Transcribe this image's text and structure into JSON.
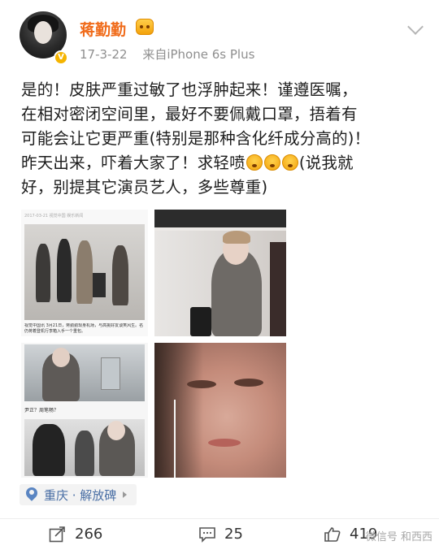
{
  "author": {
    "name": "蒋勤勤",
    "date": "17-3-22",
    "source": "来自iPhone 6s Plus"
  },
  "post": {
    "line1": "是的！皮肤严重过敏了也浮肿起来！谨遵医嘱，",
    "line2": "在相对密闭空间里，最好不要佩戴口罩，捂着有",
    "line3": "可能会让它更严重(特别是那种含化纤成分高的)！",
    "line4_a": "昨天出来，吓着大家了！求轻喷",
    "line4_b": "(说我就",
    "line5": "好，别提其它演员艺人，多些尊重)"
  },
  "images": {
    "a_header": "2017-03-21  视觉中国  娱乐新闻",
    "a_caption": "视觉中国讯 3月21日，蒋勤勤现身机场，与高挑好友谈笑风生。名仍蒋着登机行李箱入手一个重包。",
    "c_caption": "尹正？周笔畅？"
  },
  "location": {
    "label": "重庆 · 解放碑"
  },
  "actions": {
    "repost_count": "266",
    "comment_count": "25",
    "like_count": "419"
  },
  "watermark": "微信号 和西西",
  "colors": {
    "username": "#f06b1a",
    "location_text": "#4a6fa5",
    "meta_text": "#8f8f8f"
  }
}
